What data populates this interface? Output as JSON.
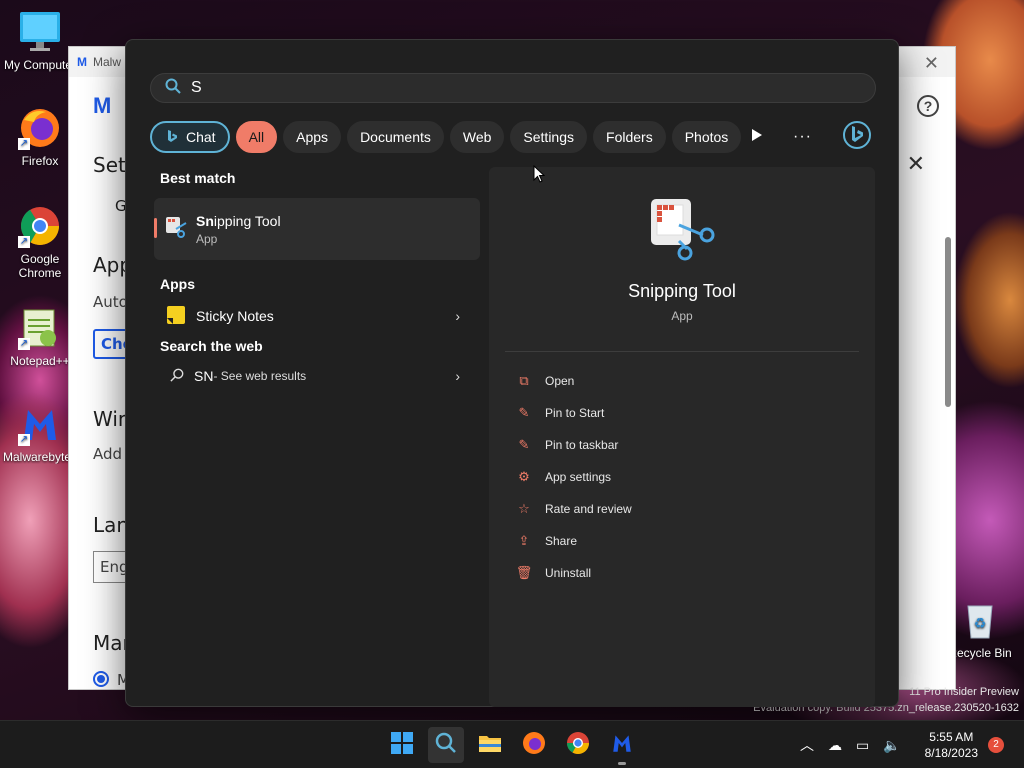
{
  "desktop": {
    "icons": [
      {
        "label": "My Computer"
      },
      {
        "label": "Firefox"
      },
      {
        "label": "Google Chrome"
      },
      {
        "label": "Notepad++"
      },
      {
        "label": "Malwarebytes"
      },
      {
        "label": "Recycle Bin"
      }
    ],
    "watermark_line1": "11 Pro Insider Preview",
    "watermark_line2": "Evaluation copy. Build 25375.zn_release.230520-1632"
  },
  "background_window": {
    "title": "Malw",
    "settings_heading": "Sett",
    "tab": "G",
    "lines": [
      "App",
      "Auto",
      "Che",
      "Win",
      "Add",
      "Lang",
      "Eng",
      "Mar",
      "M"
    ]
  },
  "search": {
    "query": "S",
    "filters": [
      {
        "label": "Chat",
        "active": false
      },
      {
        "label": "All",
        "active": true
      },
      {
        "label": "Apps",
        "active": false
      },
      {
        "label": "Documents",
        "active": false
      },
      {
        "label": "Web",
        "active": false
      },
      {
        "label": "Settings",
        "active": false
      },
      {
        "label": "Folders",
        "active": false
      },
      {
        "label": "Photos",
        "active": false
      }
    ],
    "best_match_heading": "Best match",
    "best_match": {
      "title_bold": "Sn",
      "title_rest": "ipping Tool",
      "subtitle": "App"
    },
    "apps_heading": "Apps",
    "apps": [
      {
        "label": "Sticky Notes"
      }
    ],
    "web_heading": "Search the web",
    "web_result": {
      "query": "SN",
      "suffix": " - See web results"
    },
    "detail": {
      "title": "Snipping Tool",
      "subtitle": "App",
      "actions": [
        {
          "label": "Open",
          "icon": "open-icon"
        },
        {
          "label": "Pin to Start",
          "icon": "pin-icon"
        },
        {
          "label": "Pin to taskbar",
          "icon": "pin-icon"
        },
        {
          "label": "App settings",
          "icon": "gear-icon"
        },
        {
          "label": "Rate and review",
          "icon": "star-icon"
        },
        {
          "label": "Share",
          "icon": "share-icon"
        },
        {
          "label": "Uninstall",
          "icon": "trash-icon"
        }
      ]
    },
    "accent_color": "#f07c68"
  },
  "taskbar": {
    "time": "5:55 AM",
    "date": "8/18/2023",
    "notification_count": "2"
  }
}
